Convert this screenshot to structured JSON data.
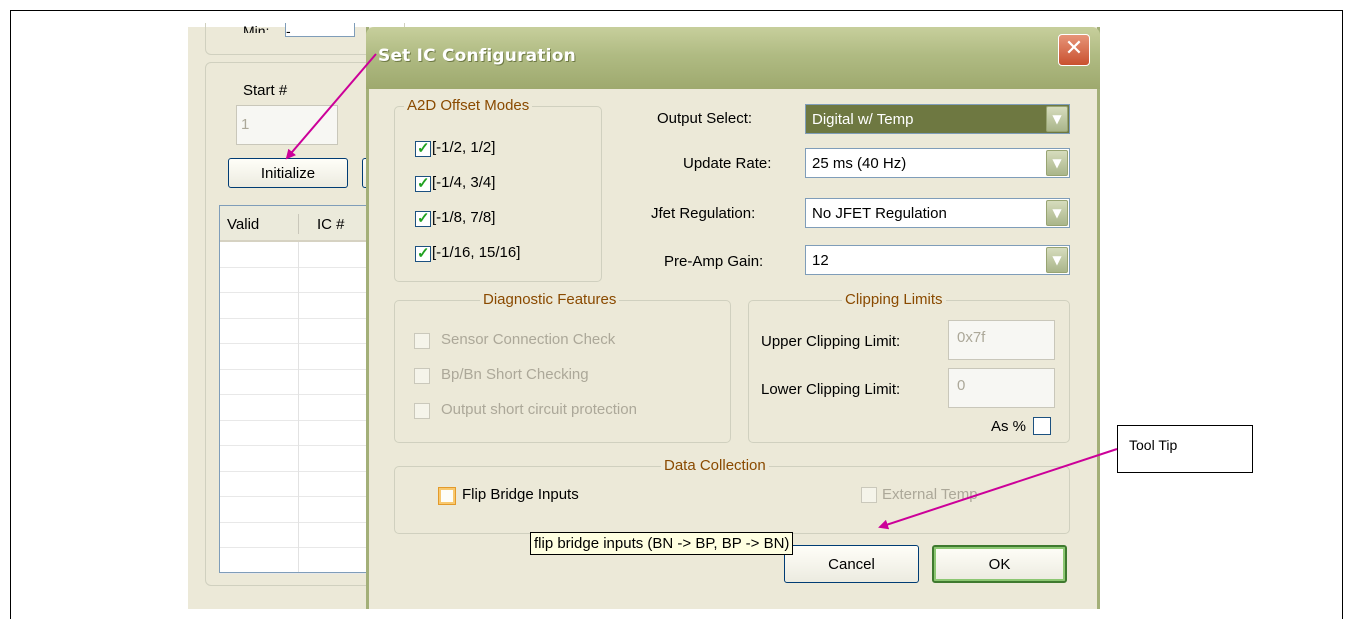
{
  "background_window": {
    "min_label": "Min:",
    "min_value": "-",
    "start_label": "Start #",
    "start_value": "1",
    "initialize_button": "Initialize",
    "table_headers": [
      "Valid",
      "IC #"
    ],
    "row_count": 13
  },
  "dialog": {
    "title": "Set IC Configuration",
    "close_label": "✕",
    "a2d": {
      "legend": "A2D Offset Modes",
      "options": [
        {
          "label": "[-1/2, 1/2]",
          "checked": true
        },
        {
          "label": "[-1/4, 3/4]",
          "checked": true
        },
        {
          "label": "[-1/8, 7/8]",
          "checked": true
        },
        {
          "label": "[-1/16, 15/16]",
          "checked": true
        }
      ]
    },
    "output_select": {
      "label": "Output Select:",
      "value": "Digital w/ Temp"
    },
    "update_rate": {
      "label": "Update Rate:",
      "value": "25 ms (40 Hz)"
    },
    "jfet_regulation": {
      "label": "Jfet Regulation:",
      "value": "No JFET Regulation"
    },
    "preamp_gain": {
      "label": "Pre-Amp Gain:",
      "value": "12"
    },
    "diagnostics": {
      "legend": "Diagnostic Features",
      "options": [
        {
          "label": "Sensor Connection Check",
          "enabled": false
        },
        {
          "label": "Bp/Bn Short Checking",
          "enabled": false
        },
        {
          "label": "Output short circuit protection",
          "enabled": false
        }
      ]
    },
    "clipping": {
      "legend": "Clipping Limits",
      "upper_label": "Upper Clipping Limit:",
      "upper_value": "0x7f",
      "lower_label": "Lower Clipping Limit:",
      "lower_value": "0",
      "as_percent_label": "As %",
      "as_percent_checked": false
    },
    "data_collection": {
      "legend": "Data Collection",
      "flip_bridge_label": "Flip Bridge Inputs",
      "flip_bridge_checked": false,
      "external_temp_label": "External Temp",
      "external_temp_enabled": false
    },
    "cancel_button": "Cancel",
    "ok_button": "OK"
  },
  "tooltip": {
    "text": "flip bridge inputs (BN -> BP, BP -> BN)"
  },
  "callout": {
    "text": "Tool Tip"
  },
  "colors": {
    "annotation_arrow": "#cc0099",
    "title_bar": "#b0bb83",
    "close_button": "#c9502f"
  }
}
